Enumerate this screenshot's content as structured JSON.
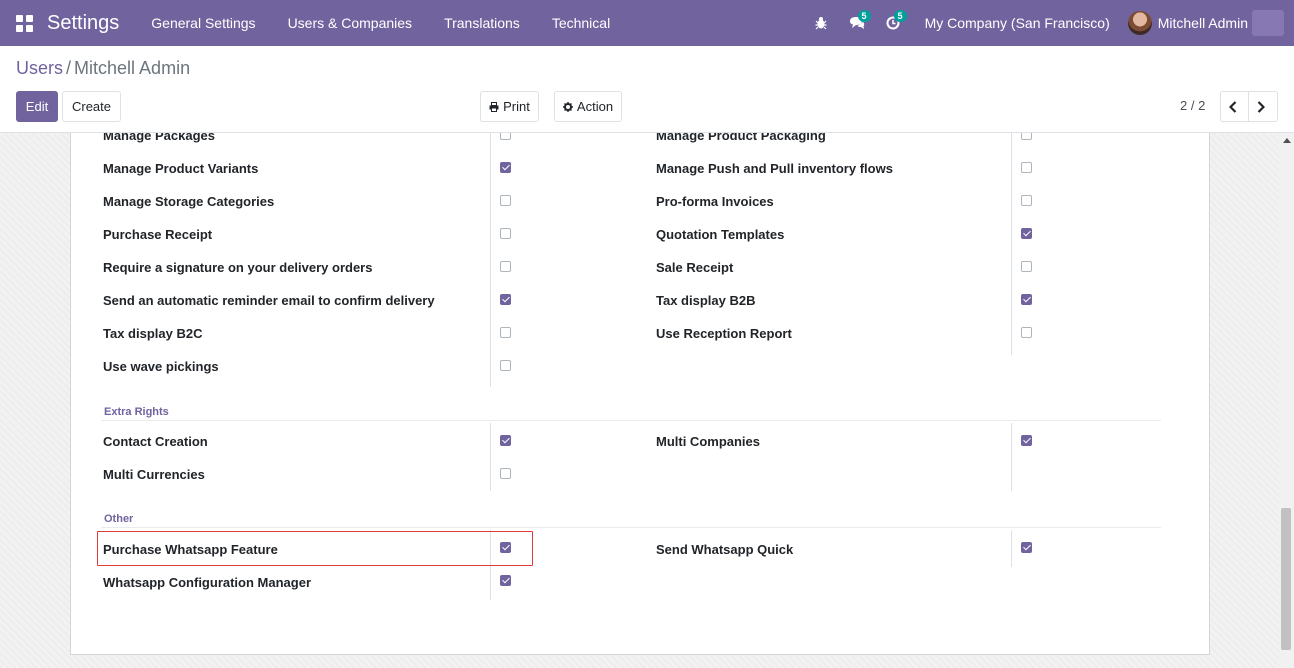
{
  "navbar": {
    "app_title": "Settings",
    "menu": [
      "General Settings",
      "Users & Companies",
      "Translations",
      "Technical"
    ],
    "messages_badge": "5",
    "activity_badge": "5",
    "company": "My Company (San Francisco)",
    "user": "Mitchell Admin",
    "icons": [
      "apps-grid-icon",
      "bug-icon",
      "chat-icon",
      "clock-icon"
    ]
  },
  "breadcrumb": {
    "parent": "Users",
    "separator": "/",
    "current": "Mitchell Admin"
  },
  "buttons": {
    "edit": "Edit",
    "create": "Create",
    "print": "Print",
    "action": "Action"
  },
  "pager": {
    "value": "2 / 2"
  },
  "rights": {
    "left": [
      {
        "label": "Manage Packages",
        "checked": false
      },
      {
        "label": "Manage Product Variants",
        "checked": true
      },
      {
        "label": "Manage Storage Categories",
        "checked": false
      },
      {
        "label": "Purchase Receipt",
        "checked": false
      },
      {
        "label": "Require a signature on your delivery orders",
        "checked": false
      },
      {
        "label": "Send an automatic reminder email to confirm delivery",
        "checked": true
      },
      {
        "label": "Tax display B2C",
        "checked": false
      },
      {
        "label": "Use wave pickings",
        "checked": false
      }
    ],
    "right": [
      {
        "label": "Manage Product Packaging",
        "checked": false
      },
      {
        "label": "Manage Push and Pull inventory flows",
        "checked": false
      },
      {
        "label": "Pro-forma Invoices",
        "checked": false
      },
      {
        "label": "Quotation Templates",
        "checked": true
      },
      {
        "label": "Sale Receipt",
        "checked": false
      },
      {
        "label": "Tax display B2B",
        "checked": true
      },
      {
        "label": "Use Reception Report",
        "checked": false
      }
    ]
  },
  "extra_rights": {
    "title": "Extra Rights",
    "left": [
      {
        "label": "Contact Creation",
        "checked": true
      },
      {
        "label": "Multi Currencies",
        "checked": false
      }
    ],
    "right": [
      {
        "label": "Multi Companies",
        "checked": true
      }
    ]
  },
  "other": {
    "title": "Other",
    "left": [
      {
        "label": "Purchase Whatsapp Feature",
        "checked": true
      },
      {
        "label": "Whatsapp Configuration Manager",
        "checked": true
      }
    ],
    "right": [
      {
        "label": "Send Whatsapp Quick",
        "checked": true
      }
    ]
  },
  "colors": {
    "brand": "#71639e",
    "highlight": "#e03a3a",
    "badge": "#00a09d"
  }
}
